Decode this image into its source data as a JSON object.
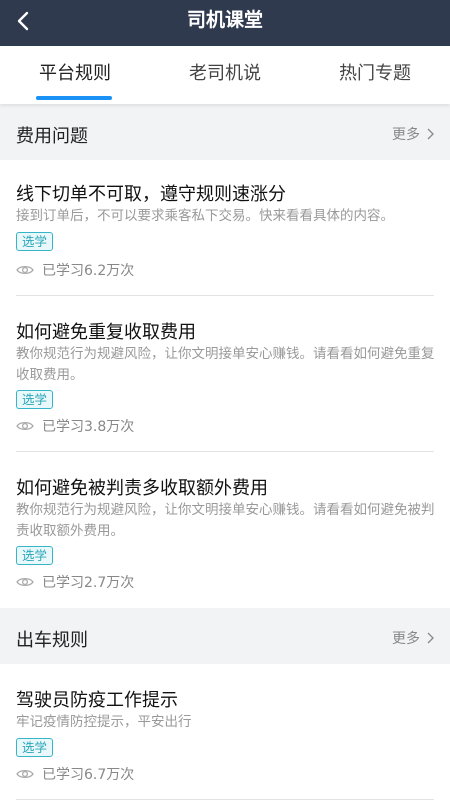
{
  "header": {
    "title": "司机课堂",
    "back_icon": "chevron-left-icon"
  },
  "tabs": [
    {
      "label": "平台规则",
      "active": true
    },
    {
      "label": "老司机说",
      "active": false
    },
    {
      "label": "热门专题",
      "active": false
    }
  ],
  "colors": {
    "header_bg": "#2f3a4f",
    "accent": "#1a91f4",
    "tag": "#36b5c9"
  },
  "sections": [
    {
      "title": "费用问题",
      "more": "更多",
      "items": [
        {
          "title": "线下切单不可取，遵守规则速涨分",
          "desc": "接到订单后，不可以要求乘客私下交易。快来看看具体的内容。",
          "tag": "选学",
          "stat": "已学习6.2万次"
        },
        {
          "title": "如何避免重复收取费用",
          "desc": "教你规范行为规避风险，让你文明接单安心赚钱。请看看如何避免重复收取费用。",
          "tag": "选学",
          "stat": "已学习3.8万次"
        },
        {
          "title": "如何避免被判责多收取额外费用",
          "desc": "教你规范行为规避风险，让你文明接单安心赚钱。请看看如何避免被判责收取额外费用。",
          "tag": "选学",
          "stat": "已学习2.7万次"
        }
      ]
    },
    {
      "title": "出车规则",
      "more": "更多",
      "items": [
        {
          "title": "驾驶员防疫工作提示",
          "desc": "牢记疫情防控提示，平安出行",
          "tag": "选学",
          "stat": "已学习6.7万次"
        }
      ]
    }
  ]
}
